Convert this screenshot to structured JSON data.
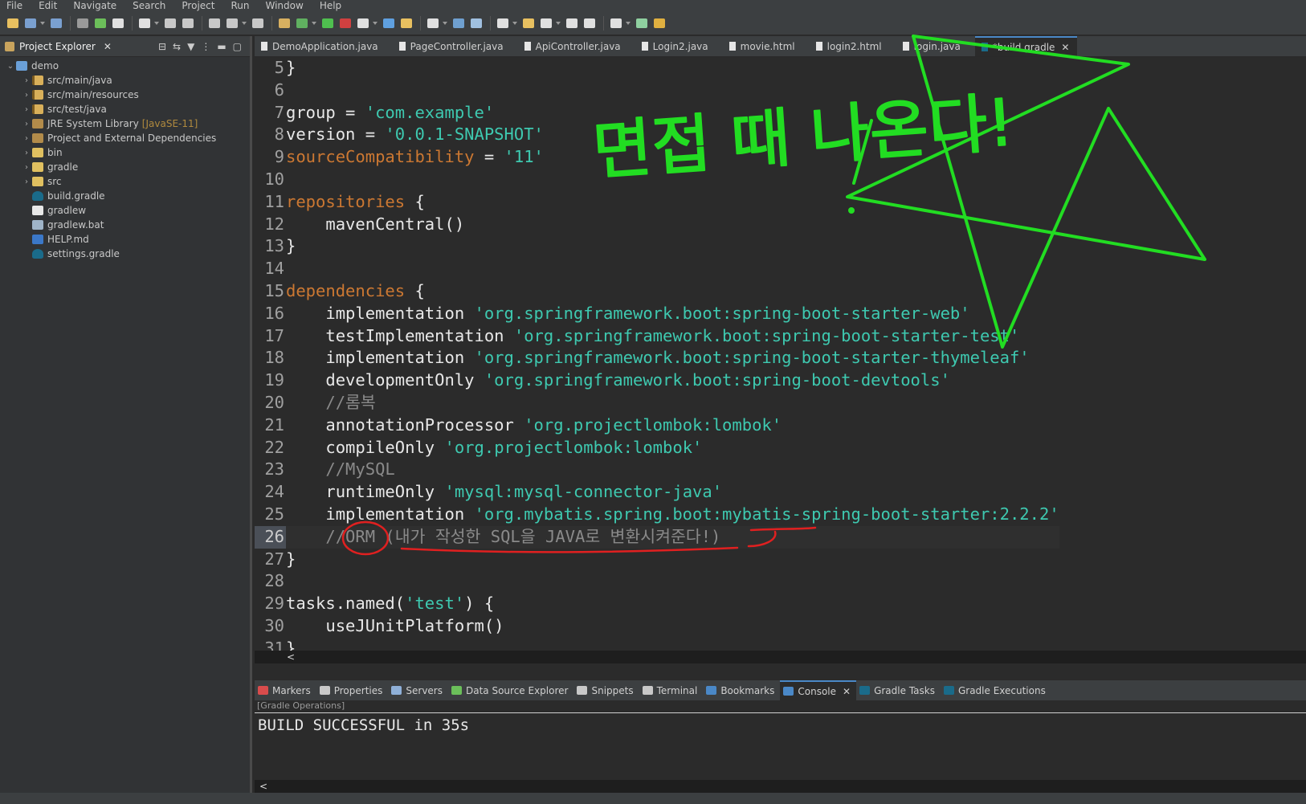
{
  "menu": [
    "File",
    "Edit",
    "Navigate",
    "Search",
    "Project",
    "Run",
    "Window",
    "Help"
  ],
  "explorer": {
    "title": "Project Explorer",
    "tree": [
      {
        "label": "demo",
        "icon": "project-icon",
        "expanded": true,
        "indent": 0
      },
      {
        "label": "src/main/java",
        "icon": "source-folder-icon",
        "indent": 1
      },
      {
        "label": "src/main/resources",
        "icon": "source-folder-icon",
        "indent": 1
      },
      {
        "label": "src/test/java",
        "icon": "source-folder-icon",
        "indent": 1
      },
      {
        "label": "JRE System Library",
        "tag": "[JavaSE-11]",
        "icon": "library-icon",
        "indent": 1
      },
      {
        "label": "Project and External Dependencies",
        "icon": "library-icon",
        "indent": 1
      },
      {
        "label": "bin",
        "icon": "folder-icon",
        "indent": 1
      },
      {
        "label": "gradle",
        "icon": "folder-icon",
        "indent": 1
      },
      {
        "label": "src",
        "icon": "folder-icon",
        "indent": 1
      },
      {
        "label": "build.gradle",
        "icon": "gradle-file-icon",
        "indent": 1,
        "leaf": true
      },
      {
        "label": "gradlew",
        "icon": "file-icon",
        "indent": 1,
        "leaf": true
      },
      {
        "label": "gradlew.bat",
        "icon": "bat-file-icon",
        "indent": 1,
        "leaf": true
      },
      {
        "label": "HELP.md",
        "icon": "markdown-file-icon",
        "indent": 1,
        "leaf": true
      },
      {
        "label": "settings.gradle",
        "icon": "gradle-file-icon",
        "indent": 1,
        "leaf": true
      }
    ]
  },
  "editor_tabs": [
    {
      "label": "DemoApplication.java",
      "active": false
    },
    {
      "label": "PageController.java",
      "active": false
    },
    {
      "label": "ApiController.java",
      "active": false
    },
    {
      "label": "Login2.java",
      "active": false
    },
    {
      "label": "movie.html",
      "active": false
    },
    {
      "label": "login2.html",
      "active": false
    },
    {
      "label": "login.java",
      "active": false
    },
    {
      "label": "*build.gradle",
      "active": true
    }
  ],
  "code": {
    "current_line": 26,
    "lines": [
      {
        "n": "5",
        "parts": [
          [
            "p",
            "}"
          ]
        ]
      },
      {
        "n": "6",
        "parts": []
      },
      {
        "n": "7",
        "parts": [
          [
            "p",
            "group = "
          ],
          [
            "s",
            "'com.example'"
          ]
        ]
      },
      {
        "n": "8",
        "parts": [
          [
            "p",
            "version = "
          ],
          [
            "s",
            "'0.0.1-SNAPSHOT'"
          ]
        ]
      },
      {
        "n": "9",
        "parts": [
          [
            "k",
            "sourceCompatibility"
          ],
          [
            "p",
            " = "
          ],
          [
            "s",
            "'11'"
          ]
        ]
      },
      {
        "n": "10",
        "parts": []
      },
      {
        "n": "11",
        "parts": [
          [
            "k",
            "repositories"
          ],
          [
            "p",
            " {"
          ]
        ]
      },
      {
        "n": "12",
        "parts": [
          [
            "p",
            "    mavenCentral()"
          ]
        ]
      },
      {
        "n": "13",
        "parts": [
          [
            "p",
            "}"
          ]
        ]
      },
      {
        "n": "14",
        "parts": []
      },
      {
        "n": "15",
        "parts": [
          [
            "k",
            "dependencies"
          ],
          [
            "p",
            " {"
          ]
        ]
      },
      {
        "n": "16",
        "parts": [
          [
            "p",
            "    implementation "
          ],
          [
            "s",
            "'org.springframework.boot:spring-boot-starter-web'"
          ]
        ]
      },
      {
        "n": "17",
        "parts": [
          [
            "p",
            "    testImplementation "
          ],
          [
            "s",
            "'org.springframework.boot:spring-boot-starter-test'"
          ]
        ]
      },
      {
        "n": "18",
        "parts": [
          [
            "p",
            "    implementation "
          ],
          [
            "s",
            "'org.springframework.boot:spring-boot-starter-thymeleaf'"
          ]
        ]
      },
      {
        "n": "19",
        "parts": [
          [
            "p",
            "    developmentOnly "
          ],
          [
            "s",
            "'org.springframework.boot:spring-boot-devtools'"
          ]
        ]
      },
      {
        "n": "20",
        "parts": [
          [
            "c",
            "    //롬복"
          ]
        ]
      },
      {
        "n": "21",
        "parts": [
          [
            "p",
            "    annotationProcessor "
          ],
          [
            "s",
            "'org.projectlombok:lombok'"
          ]
        ]
      },
      {
        "n": "22",
        "parts": [
          [
            "p",
            "    compileOnly "
          ],
          [
            "s",
            "'org.projectlombok:lombok'"
          ]
        ]
      },
      {
        "n": "23",
        "parts": [
          [
            "c",
            "    //MySQL"
          ]
        ]
      },
      {
        "n": "24",
        "parts": [
          [
            "p",
            "    runtimeOnly "
          ],
          [
            "s",
            "'mysql:mysql-connector-java'"
          ]
        ]
      },
      {
        "n": "25",
        "parts": [
          [
            "p",
            "    implementation "
          ],
          [
            "s",
            "'org.mybatis.spring.boot:mybatis-spring-boot-starter:2.2.2'"
          ]
        ]
      },
      {
        "n": "26",
        "parts": [
          [
            "c",
            "    //ORM (내가 작성한 SQL을 JAVA로 변환시켜준다!)"
          ]
        ]
      },
      {
        "n": "27",
        "parts": [
          [
            "p",
            "}"
          ]
        ]
      },
      {
        "n": "28",
        "parts": []
      },
      {
        "n": "29",
        "parts": [
          [
            "p",
            "tasks.named("
          ],
          [
            "s",
            "'test'"
          ],
          [
            "p",
            ") {"
          ]
        ]
      },
      {
        "n": "30",
        "parts": [
          [
            "p",
            "    useJUnitPlatform()"
          ]
        ]
      },
      {
        "n": "31",
        "parts": [
          [
            "p",
            "}"
          ]
        ]
      }
    ]
  },
  "scroll_left_glyph": "<",
  "bottom_tabs": [
    {
      "label": "Markers",
      "icon": "markers-icon",
      "color": "#d94c4c"
    },
    {
      "label": "Properties",
      "icon": "properties-icon",
      "color": "#c8c8c8"
    },
    {
      "label": "Servers",
      "icon": "servers-icon",
      "color": "#8fb0d8"
    },
    {
      "label": "Data Source Explorer",
      "icon": "data-source-icon",
      "color": "#6bbf5a"
    },
    {
      "label": "Snippets",
      "icon": "snippets-icon",
      "color": "#c8c8c8"
    },
    {
      "label": "Terminal",
      "icon": "terminal-icon",
      "color": "#c8c8c8"
    },
    {
      "label": "Bookmarks",
      "icon": "bookmarks-icon",
      "color": "#4a88c7"
    },
    {
      "label": "Console",
      "icon": "console-icon",
      "color": "#4a88c7",
      "active": true
    },
    {
      "label": "Gradle Tasks",
      "icon": "gradle-icon",
      "color": "#1a6b8a"
    },
    {
      "label": "Gradle Executions",
      "icon": "gradle-icon",
      "color": "#1a6b8a"
    }
  ],
  "console": {
    "header": "[Gradle Operations]",
    "output": "BUILD SUCCESSFUL in 35s"
  },
  "annotations": {
    "handwriting": "면접 때 나온다!",
    "green_color": "#22dd22",
    "red_color": "#e02020"
  }
}
